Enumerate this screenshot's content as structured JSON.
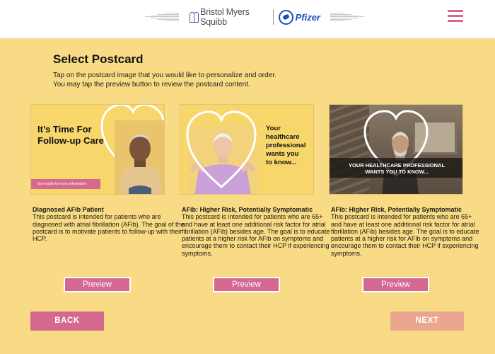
{
  "header": {
    "brand_bms": "Bristol Myers Squibb",
    "brand_pfizer": "Pfizer",
    "menu_icon": "hamburger-menu-icon"
  },
  "page": {
    "title": "Select Postcard",
    "instruction_line1": "Tap on the postcard image that you would like to personalize and order.",
    "instruction_line2": "You may tap the preview button to review the postcard content."
  },
  "postcards": [
    {
      "image_headline_line1": "It’s Time For",
      "image_headline_line2": "Follow-up Care",
      "image_ribbon": "See inside for more information",
      "title": "Diagnosed AFib Patient",
      "description": "This postcard is intended for patients who are diagnosed with atrial fibrillation (AFib). The goal of the postcard is to motivate patients to follow-up with their HCP.",
      "preview_label": "Preview"
    },
    {
      "image_headline_line1": "Your",
      "image_headline_line2": "healthcare",
      "image_headline_line3": "professional",
      "image_headline_line4": "wants you",
      "image_headline_line5": "to know...",
      "title": "AFib: Higher Risk, Potentially Symptomatic",
      "description": "This postcard is intended for patients who are 65+ and have at least one additional risk factor for atrial fibrillation (AFib) besides age. The goal is to educate patients at a higher risk for AFib on symptoms and encourage them to contact their HCP if experiencing symptoms.",
      "preview_label": "Preview"
    },
    {
      "image_banner_line1": "YOUR HEALTHCARE PROFESSIONAL",
      "image_banner_line2": "WANTS YOU TO KNOW...",
      "title": "AFib: Higher Risk, Potentially Symptomatic",
      "description": "This postcard is intended for patients who are 65+ and have at least one additional risk factor for atrial fibrillation (AFib) besides age. The goal is to educate patients at a higher risk for AFib on symptoms and encourage them to contact their HCP if experiencing symptoms.",
      "preview_label": "Preview"
    }
  ],
  "nav": {
    "back_label": "BACK",
    "next_label": "NEXT"
  },
  "colors": {
    "background": "#f8db84",
    "accent_pink": "#d4688e",
    "next_disabled": "#eaa68e",
    "pfizer_blue": "#1a4fbf",
    "bms_purple": "#7b3fa0"
  }
}
